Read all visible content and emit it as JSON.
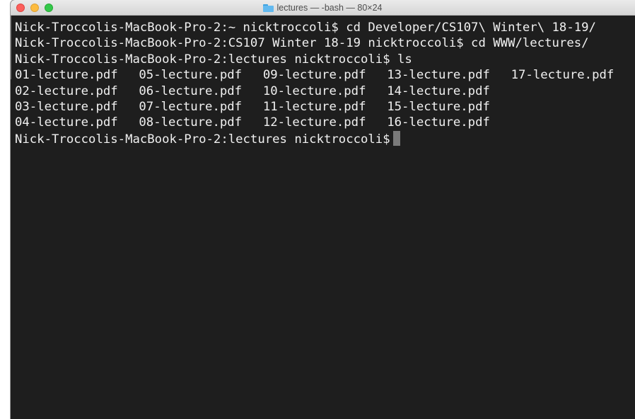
{
  "window": {
    "title": "lectures — -bash — 80×24"
  },
  "terminal": {
    "lines": [
      "Nick-Troccolis-MacBook-Pro-2:~ nicktroccoli$ cd Developer/CS107\\ Winter\\ 18-19/",
      "Nick-Troccolis-MacBook-Pro-2:CS107 Winter 18-19 nicktroccoli$ cd WWW/lectures/",
      "Nick-Troccolis-MacBook-Pro-2:lectures nicktroccoli$ ls"
    ],
    "ls_columns": [
      [
        "01-lecture.pdf",
        "02-lecture.pdf",
        "03-lecture.pdf",
        "04-lecture.pdf"
      ],
      [
        "05-lecture.pdf",
        "06-lecture.pdf",
        "07-lecture.pdf",
        "08-lecture.pdf"
      ],
      [
        "09-lecture.pdf",
        "10-lecture.pdf",
        "11-lecture.pdf",
        "12-lecture.pdf"
      ],
      [
        "13-lecture.pdf",
        "14-lecture.pdf",
        "15-lecture.pdf",
        "16-lecture.pdf"
      ],
      [
        "17-lecture.pdf"
      ]
    ],
    "prompt": "Nick-Troccolis-MacBook-Pro-2:lectures nicktroccoli$"
  },
  "colors": {
    "background": "#1e1e1e",
    "text": "#f0f0f0",
    "cursor": "#7a7a7a"
  },
  "icons": {
    "title_icon": "folder-icon"
  }
}
